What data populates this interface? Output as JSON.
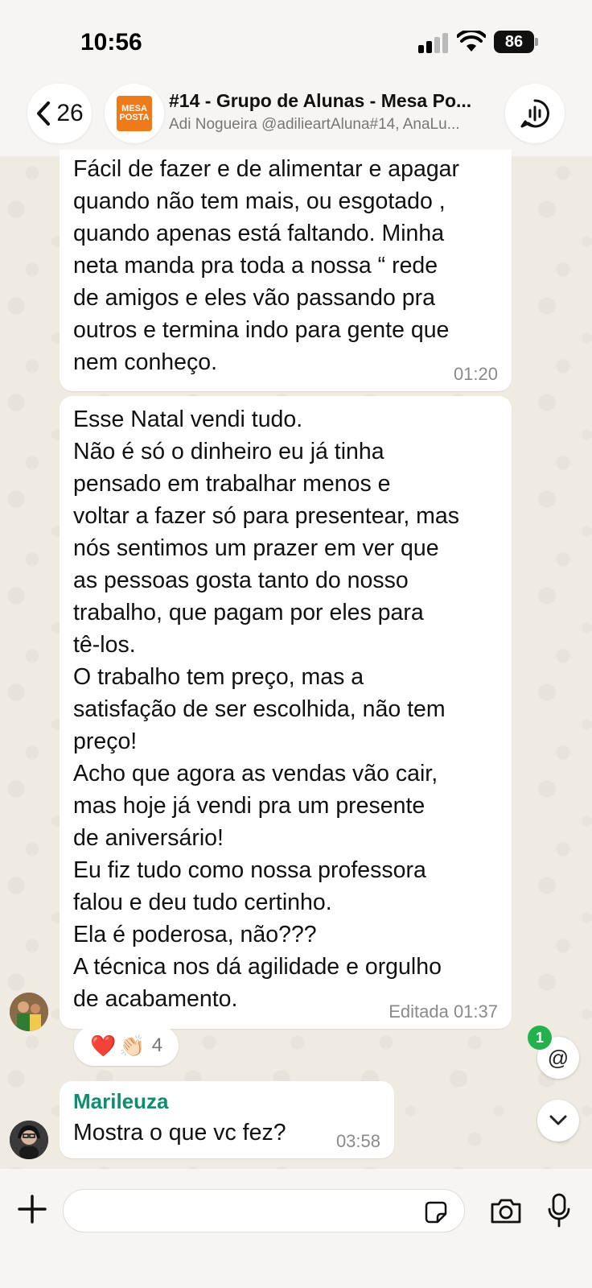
{
  "status_bar": {
    "time": "10:56",
    "battery": "86"
  },
  "header": {
    "back_count": "26",
    "group_title": "#14 - Grupo de Alunas - Mesa Po...",
    "group_members": "Adi Nogueira @adilieartAluna#14, AnaLu...",
    "logo_line1": "MESA",
    "logo_line2": "POSTA",
    "logo_sub": "porto guardanapos",
    "icons": {
      "back": "chevron-left-icon",
      "call": "voice-waveform-icon"
    }
  },
  "messages": [
    {
      "text": "Fácil de fazer e de alimentar e apagar\nquando não tem mais, ou esgotado ,\nquando apenas está faltando.  Minha\nneta manda pra toda a nossa “ rede\nde amigos e eles vão passando pra\noutros e termina indo para gente que\nnem conheço.",
      "time": "01:20"
    },
    {
      "text": "Esse Natal vendi tudo.\nNão é só o dinheiro eu já tinha\npensado em trabalhar menos e\nvoltar a fazer só para presentear, mas\nnós sentimos um prazer em ver que\nas pessoas gosta tanto do nosso\ntrabalho, que pagam por eles para\ntê-los.\nO trabalho tem preço, mas a\nsatisfação de ser escolhida, não tem\npreço!\nAcho que agora as vendas vão cair,\nmas hoje  já vendi pra um presente\nde aniversário!\nEu fiz tudo como nossa professora\nfalou e deu tudo certinho.\nEla é poderosa, não???\nA técnica nos dá agilidade e orgulho\nde acabamento.",
      "time": "Editada 01:37",
      "reactions": {
        "emojis": [
          "❤️",
          "👏🏻"
        ],
        "count": "4"
      }
    },
    {
      "sender": "Marileuza",
      "sender_color": "#108c6e",
      "text": "Mostra o que vc fez?",
      "time": "03:58"
    }
  ],
  "floating": {
    "mention_symbol": "@",
    "mention_badge": "1"
  },
  "input_bar": {
    "placeholder": "",
    "icons": [
      "plus-icon",
      "sticker-icon",
      "camera-icon",
      "microphone-icon"
    ]
  },
  "colors": {
    "background": "#efeae2",
    "bubble": "#ffffff",
    "accent_green": "#22b14c",
    "sender_name": "#108c6e",
    "logo_orange": "#ef7a1a"
  }
}
